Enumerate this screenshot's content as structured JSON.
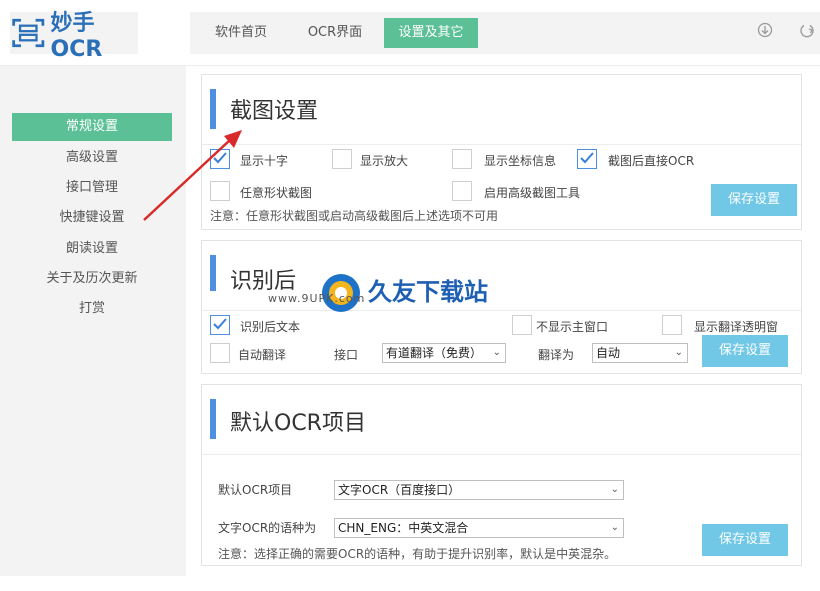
{
  "app": {
    "name": "妙手OCR"
  },
  "nav": {
    "tabs": [
      {
        "label": "软件首页"
      },
      {
        "label": "OCR界面"
      },
      {
        "label": "设置及其它"
      }
    ]
  },
  "sidebar": {
    "items": [
      {
        "label": "常规设置"
      },
      {
        "label": "高级设置"
      },
      {
        "label": "接口管理"
      },
      {
        "label": "快捷键设置"
      },
      {
        "label": "朗读设置"
      },
      {
        "label": "关于及历次更新"
      },
      {
        "label": "打赏"
      }
    ]
  },
  "screenshot_settings": {
    "title": "截图设置",
    "options": [
      {
        "label": "显示十字",
        "checked": true
      },
      {
        "label": "显示放大",
        "checked": false
      },
      {
        "label": "显示坐标信息",
        "checked": false
      },
      {
        "label": "截图后直接OCR",
        "checked": true
      },
      {
        "label": "任意形状截图",
        "checked": false
      },
      {
        "label": "启用高级截图工具",
        "checked": false
      }
    ],
    "note": "注意：任意形状截图或启动高级截图后上述选项不可用",
    "save_label": "保存设置"
  },
  "recognition_settings": {
    "title": "识别后",
    "options": [
      {
        "label": "识别后文本",
        "checked": true
      },
      {
        "label": "不显示主窗口",
        "checked": false
      },
      {
        "label": "显示翻译透明窗",
        "checked": false
      },
      {
        "label": "自动翻译",
        "checked": false
      }
    ],
    "interface_label": "接口",
    "interface_value": "有道翻译（免费）",
    "translate_to_label": "翻译为",
    "translate_to_value": "自动",
    "save_label": "保存设置"
  },
  "default_ocr": {
    "title": "默认OCR项目",
    "project_label": "默认OCR项目",
    "project_value": "文字OCR（百度接口）",
    "language_label": "文字OCR的语种为",
    "language_value": "CHN_ENG：中英文混合",
    "note": "注意：选择正确的需要OCR的语种，有助于提升识别率，默认是中英混杂。",
    "save_label": "保存设置"
  },
  "watermark": {
    "brand": "久友下载站",
    "url": "www.9UPK.com"
  },
  "colors": {
    "accent_green": "#5cc096",
    "accent_blue": "#4d8fe0",
    "button_blue": "#70c7e6",
    "arrow_red": "#d92a2a"
  }
}
